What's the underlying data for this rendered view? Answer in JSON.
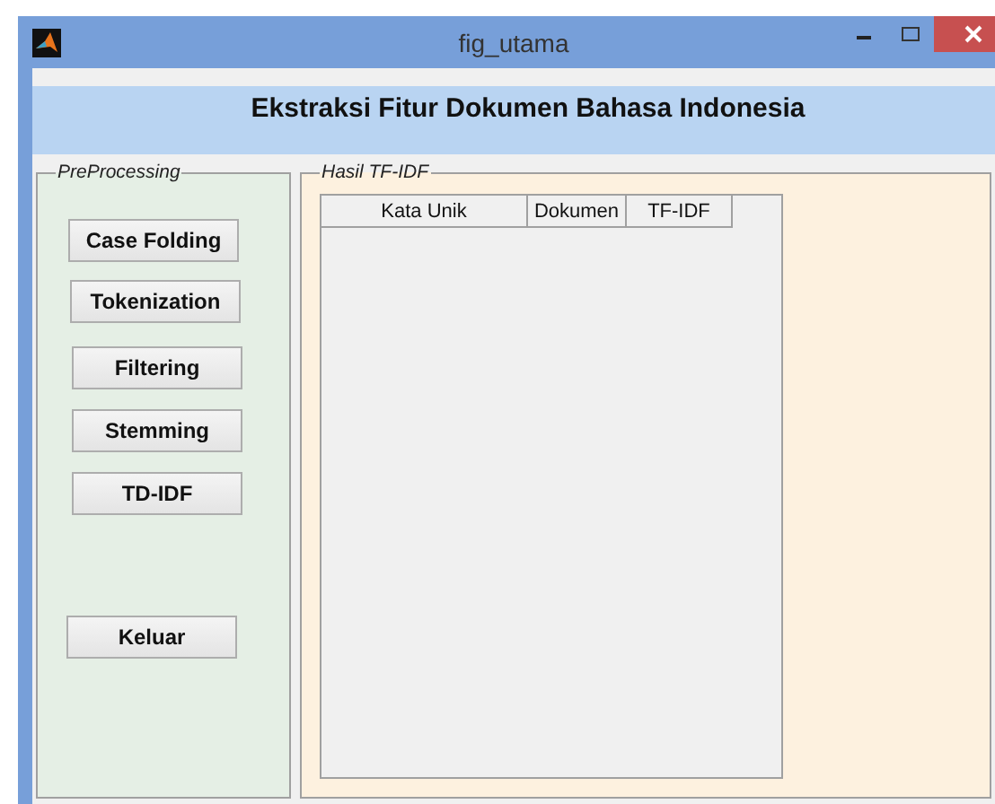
{
  "window": {
    "title": "fig_utama"
  },
  "header": {
    "title": "Ekstraksi Fitur Dokumen Bahasa Indonesia"
  },
  "preprocessing": {
    "title": "PreProcessing",
    "buttons": [
      "Case Folding",
      "Tokenization",
      "Filtering",
      "Stemming",
      "TD-IDF",
      "Keluar"
    ]
  },
  "results": {
    "title": "Hasil TF-IDF",
    "table": {
      "columns": [
        "Kata Unik",
        "Dokumen",
        "TF-IDF"
      ]
    }
  }
}
